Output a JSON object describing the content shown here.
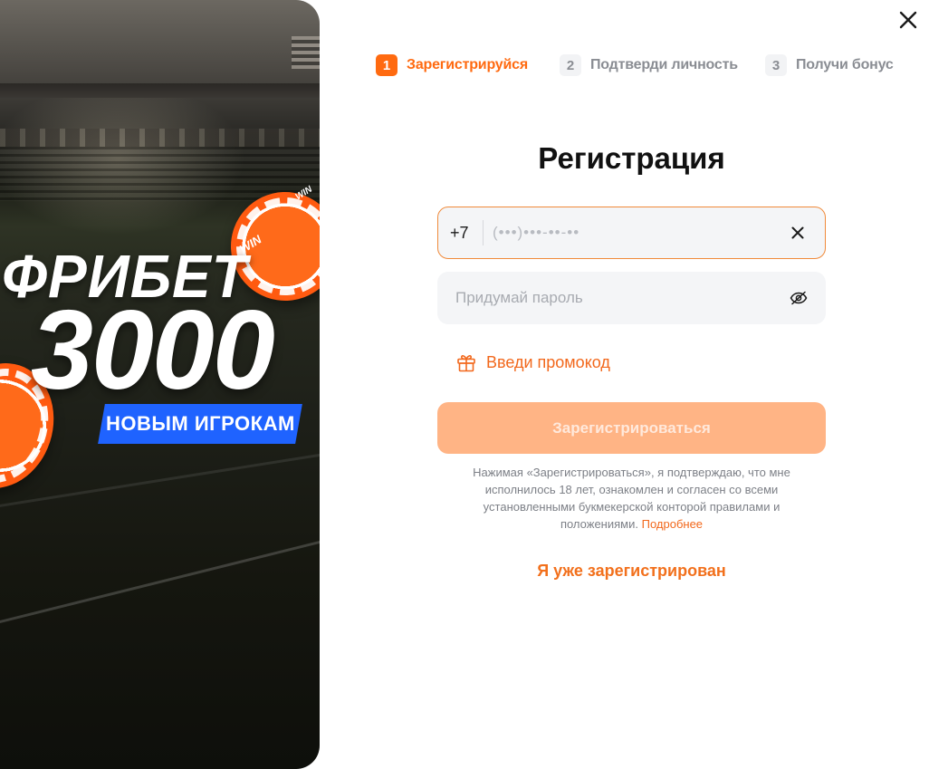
{
  "promo": {
    "title": "ФРИБЕТ",
    "amount": "3000",
    "badge": "НОВЫМ ИГРОКАМ",
    "chip_text": "WIN"
  },
  "steps": [
    {
      "number": "1",
      "label": "Зарегистрируйся",
      "active": true
    },
    {
      "number": "2",
      "label": "Подтверди личность",
      "active": false
    },
    {
      "number": "3",
      "label": "Получи бонус",
      "active": false
    }
  ],
  "form": {
    "title": "Регистрация",
    "phone_prefix": "+7",
    "phone_placeholder": "(•••)•••-••-••",
    "password_placeholder": "Придумай пароль",
    "promo_code_label": "Введи промокод",
    "submit_label": "Зарегистрироваться",
    "legal_text": "Нажимая «Зарегистрироваться», я подтверждаю, что мне исполнилось 18 лет, ознакомлен и согласен со всеми установленными букмекерской конторой правилами и положениями.",
    "legal_link": "Подробнее",
    "login_link": "Я уже зарегистрирован"
  },
  "icons": {
    "close": "close-icon",
    "clear": "clear-icon",
    "eye": "eye-off-icon",
    "gift": "gift-icon"
  },
  "colors": {
    "accent": "#ff6a10",
    "submit_disabled": "#ffb485",
    "badge_blue": "#1f63ff"
  }
}
